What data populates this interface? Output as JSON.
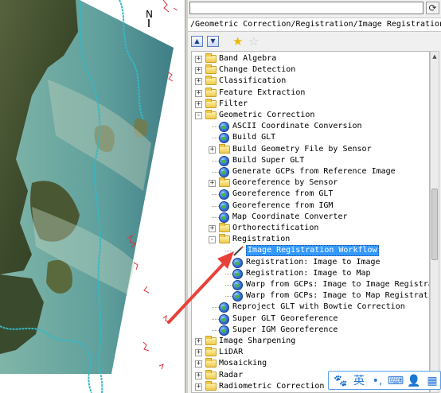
{
  "map": {
    "north_label": "N",
    "colors": {
      "water": "#6aa9a6",
      "land": "#3d4a2c",
      "outline": "#35b8c4",
      "red_vector": "#e0303a"
    }
  },
  "toolbox": {
    "search": {
      "value": "",
      "placeholder": ""
    },
    "refresh_icon": "refresh-icon",
    "path": "/Geometric Correction/Registration/Image Registration Workflow",
    "toolbar": {
      "expand_icon": "chevron-down-icon",
      "collapse_icon": "chevron-up-icon",
      "add_favorite_icon": "add-favorite-star-icon",
      "remove_favorite_icon": "remove-favorite-star-icon"
    },
    "tree": [
      {
        "label": "Band Algebra",
        "level": 0,
        "type": "folder",
        "expander": "+"
      },
      {
        "label": "Change Detection",
        "level": 0,
        "type": "folder",
        "expander": "+"
      },
      {
        "label": "Classification",
        "level": 0,
        "type": "folder",
        "expander": "+"
      },
      {
        "label": "Feature Extraction",
        "level": 0,
        "type": "folder",
        "expander": "+"
      },
      {
        "label": "Filter",
        "level": 0,
        "type": "folder",
        "expander": "+"
      },
      {
        "label": "Geometric Correction",
        "level": 0,
        "type": "folder",
        "expander": "-"
      },
      {
        "label": "ASCII Coordinate Conversion",
        "level": 1,
        "type": "tool",
        "expander": ""
      },
      {
        "label": "Build GLT",
        "level": 1,
        "type": "tool",
        "expander": ""
      },
      {
        "label": "Build Geometry File by Sensor",
        "level": 1,
        "type": "folder",
        "expander": "+"
      },
      {
        "label": "Build Super GLT",
        "level": 1,
        "type": "tool",
        "expander": ""
      },
      {
        "label": "Generate GCPs from Reference Image",
        "level": 1,
        "type": "tool",
        "expander": ""
      },
      {
        "label": "Georeference by Sensor",
        "level": 1,
        "type": "folder",
        "expander": "+"
      },
      {
        "label": "Georeference from GLT",
        "level": 1,
        "type": "tool",
        "expander": ""
      },
      {
        "label": "Georeference from IGM",
        "level": 1,
        "type": "tool",
        "expander": ""
      },
      {
        "label": "Map Coordinate Converter",
        "level": 1,
        "type": "tool",
        "expander": ""
      },
      {
        "label": "Orthorectification",
        "level": 1,
        "type": "folder",
        "expander": "+"
      },
      {
        "label": "Registration",
        "level": 1,
        "type": "folder",
        "expander": "-"
      },
      {
        "label": "Image Registration Workflow",
        "level": 2,
        "type": "wand",
        "expander": "",
        "selected": true
      },
      {
        "label": "Registration: Image to Image",
        "level": 2,
        "type": "tool",
        "expander": ""
      },
      {
        "label": "Registration: Image to Map",
        "level": 2,
        "type": "tool",
        "expander": ""
      },
      {
        "label": "Warp from GCPs: Image to Image Registration",
        "level": 2,
        "type": "tool",
        "expander": ""
      },
      {
        "label": "Warp from GCPs: Image to Map Registration",
        "level": 2,
        "type": "tool",
        "expander": ""
      },
      {
        "label": "Reproject GLT with Bowtie Correction",
        "level": 1,
        "type": "tool",
        "expander": ""
      },
      {
        "label": "Super GLT Georeference",
        "level": 1,
        "type": "tool",
        "expander": ""
      },
      {
        "label": "Super IGM Georeference",
        "level": 1,
        "type": "tool",
        "expander": ""
      },
      {
        "label": "Image Sharpening",
        "level": 0,
        "type": "folder",
        "expander": "+"
      },
      {
        "label": "LiDAR",
        "level": 0,
        "type": "folder",
        "expander": "+"
      },
      {
        "label": "Mosaicking",
        "level": 0,
        "type": "folder",
        "expander": "+"
      },
      {
        "label": "Radar",
        "level": 0,
        "type": "folder",
        "expander": "+"
      },
      {
        "label": "Radiometric Correction",
        "level": 0,
        "type": "folder",
        "expander": "+"
      }
    ]
  },
  "ime": {
    "items": [
      {
        "icon": "paw-icon",
        "glyph": "🐾"
      },
      {
        "icon": "english-mode-icon",
        "glyph": "英"
      },
      {
        "icon": "punctuation-icon",
        "glyph": "•,"
      },
      {
        "icon": "keyboard-icon",
        "glyph": "⌨"
      },
      {
        "icon": "user-icon",
        "glyph": "👤"
      },
      {
        "icon": "grid-menu-icon",
        "glyph": "▦"
      }
    ]
  },
  "annotation": {
    "arrow_color": "#e8413a",
    "arrow_icon": "pointer-arrow-icon"
  }
}
